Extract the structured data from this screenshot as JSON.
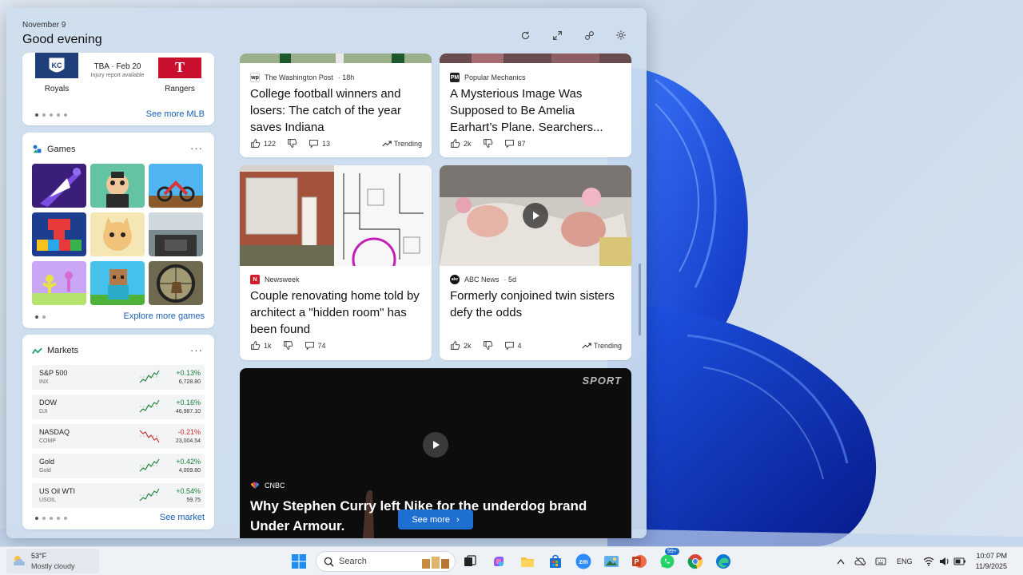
{
  "board": {
    "date": "November 9",
    "greeting": "Good evening"
  },
  "header_icons": [
    "refresh-icon",
    "expand-icon",
    "personalize-icon",
    "settings-icon"
  ],
  "mlb": {
    "team_home": "Royals",
    "team_away": "Rangers",
    "home_abbr": "KC",
    "away_abbr": "T",
    "game_line": "TBA · Feb 20",
    "game_note": "Injury report available",
    "link": "See more MLB"
  },
  "games": {
    "title": "Games",
    "more": "···",
    "link": "Explore more games"
  },
  "markets": {
    "title": "Markets",
    "more": "···",
    "link": "See market",
    "rows": [
      {
        "symbol": "S&P 500",
        "sub": "INX",
        "change": "+0.13%",
        "price": "6,728.80",
        "dir": "up"
      },
      {
        "symbol": "DOW",
        "sub": "DJI",
        "change": "+0.16%",
        "price": "46,987.10",
        "dir": "up"
      },
      {
        "symbol": "NASDAQ",
        "sub": "COMP",
        "change": "-0.21%",
        "price": "23,004.54",
        "dir": "down"
      },
      {
        "symbol": "Gold",
        "sub": "Gold",
        "change": "+0.42%",
        "price": "4,009.80",
        "dir": "up"
      },
      {
        "symbol": "US Oil WTI",
        "sub": "USOIL",
        "change": "+0.54%",
        "price": "59.75",
        "dir": "up"
      }
    ]
  },
  "news": [
    {
      "source": "The Washington Post",
      "age": "· 18h",
      "headline": "College football winners and losers: The catch of the year saves Indiana",
      "likes": "122",
      "comments": "13",
      "trending": "Trending"
    },
    {
      "source": "Popular Mechanics",
      "age": "",
      "headline": "A Mysterious Image Was Supposed to Be Amelia Earhart’s Plane. Searchers...",
      "likes": "2k",
      "comments": "87",
      "trending": ""
    },
    {
      "source": "Newsweek",
      "age": "",
      "headline": "Couple renovating home told by architect a \"hidden room\" has been found",
      "likes": "1k",
      "comments": "74",
      "trending": ""
    },
    {
      "source": "ABC News",
      "age": "· 5d",
      "headline": "Formerly conjoined twin sisters defy the odds",
      "likes": "2k",
      "comments": "4",
      "trending": "Trending"
    }
  ],
  "source_logos": {
    "wp": "wp",
    "pm": "PM",
    "nw": "N",
    "abc": "abc"
  },
  "video": {
    "tag": "SPORT",
    "source": "CNBC",
    "headline": "Why Stephen Curry left Nike for the underdog brand Under Armour.",
    "button": "See more"
  },
  "taskbar": {
    "temp": "53°F",
    "condition": "Mostly cloudy",
    "search_label": "Search",
    "badge": "99+",
    "lang": "ENG",
    "time": "10:07 PM",
    "date": "11/9/2025"
  },
  "colors": {
    "accent": "#1f6fd1",
    "up": "#1a7f37",
    "down": "#c62828"
  }
}
